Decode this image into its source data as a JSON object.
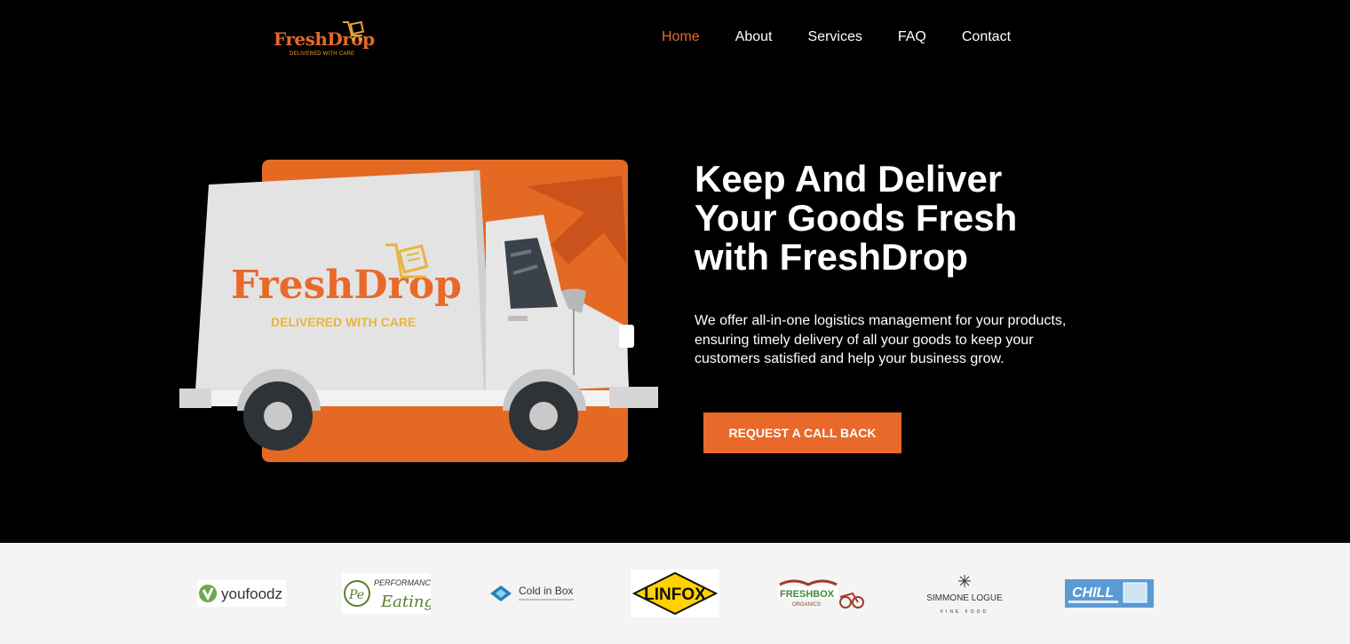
{
  "brand": {
    "name": "FreshDrop",
    "tagline": "DELIVERED WITH CARE",
    "accent_color": "#e8692a",
    "tagline_color": "#e9a23b"
  },
  "nav": {
    "items": [
      {
        "label": "Home",
        "active": true
      },
      {
        "label": "About",
        "active": false
      },
      {
        "label": "Services",
        "active": false
      },
      {
        "label": "FAQ",
        "active": false
      },
      {
        "label": "Contact",
        "active": false
      }
    ]
  },
  "hero": {
    "title_lines": [
      "Keep And Deliver",
      "Your Goods Fresh",
      "with FreshDrop"
    ],
    "text_lines": [
      "We offer all-in-one logistics management for your products,",
      "ensuring timely delivery of all your goods to keep your",
      "customers satisfied and help your business grow."
    ],
    "cta_label": "REQUEST A CALL BACK",
    "truck_brand": "FreshDrop",
    "truck_tagline": "DELIVERED WITH CARE"
  },
  "partners": [
    {
      "name": "youfoodz",
      "icon": "youfoodz-logo"
    },
    {
      "name": "PERFORMANCE",
      "sub": "Eating",
      "icon": "performance-eating-logo"
    },
    {
      "name": "Cold in Box",
      "icon": "cold-in-box-logo"
    },
    {
      "name": "LINFOX",
      "icon": "linfox-logo"
    },
    {
      "name": "FRESHBOX",
      "sub": "ORGANICS",
      "icon": "freshbox-organics-logo"
    },
    {
      "name": "SIMMONE LOGUE",
      "sub": "FINE FOOD",
      "icon": "simmone-logue-logo"
    },
    {
      "name": "CHILL",
      "icon": "chill-logo"
    }
  ]
}
